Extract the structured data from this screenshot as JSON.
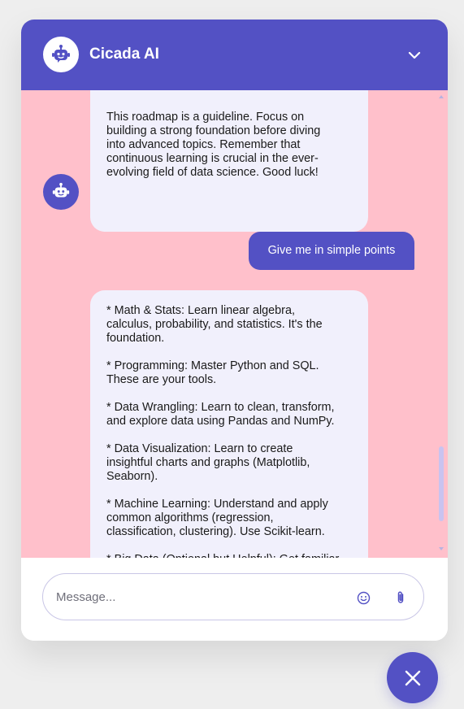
{
  "header": {
    "title": "Cicada AI",
    "avatar_icon": "robot-icon",
    "collapse_icon": "chevron-down-icon"
  },
  "messages": [
    {
      "role": "bot",
      "text": "This roadmap is a guideline. Focus on\nbuilding a strong foundation before diving\ninto advanced topics. Remember that\ncontinuous learning is crucial in the ever-\nevolving field of data science. Good luck!"
    },
    {
      "role": "user",
      "text": "Give me in simple points"
    },
    {
      "role": "bot",
      "text": "* Math & Stats: Learn linear algebra,\ncalculus, probability, and statistics. It's the\nfoundation.\n\n* Programming: Master Python and SQL.\nThese are your tools.\n\n* Data Wrangling: Learn to clean, transform,\nand explore data using Pandas and NumPy.\n\n* Data Visualization: Learn to create\ninsightful charts and graphs (Matplotlib,\nSeaborn).\n\n* Machine Learning: Understand and apply\ncommon algorithms (regression,\nclassification, clustering). Use Scikit-learn.\n\n* Big Data (Optional but Helpful): Get familiar\nwith Spark or Hadoop (for very large"
    }
  ],
  "composer": {
    "placeholder": "Message...",
    "emoji_icon": "smiley-icon",
    "attach_icon": "paperclip-icon"
  },
  "launcher": {
    "icon": "close-icon"
  },
  "colors": {
    "accent": "#5351c4",
    "messages_background": "#ffc0cb",
    "bot_bubble": "#f1f0fc",
    "page_background": "#eeeeee"
  }
}
